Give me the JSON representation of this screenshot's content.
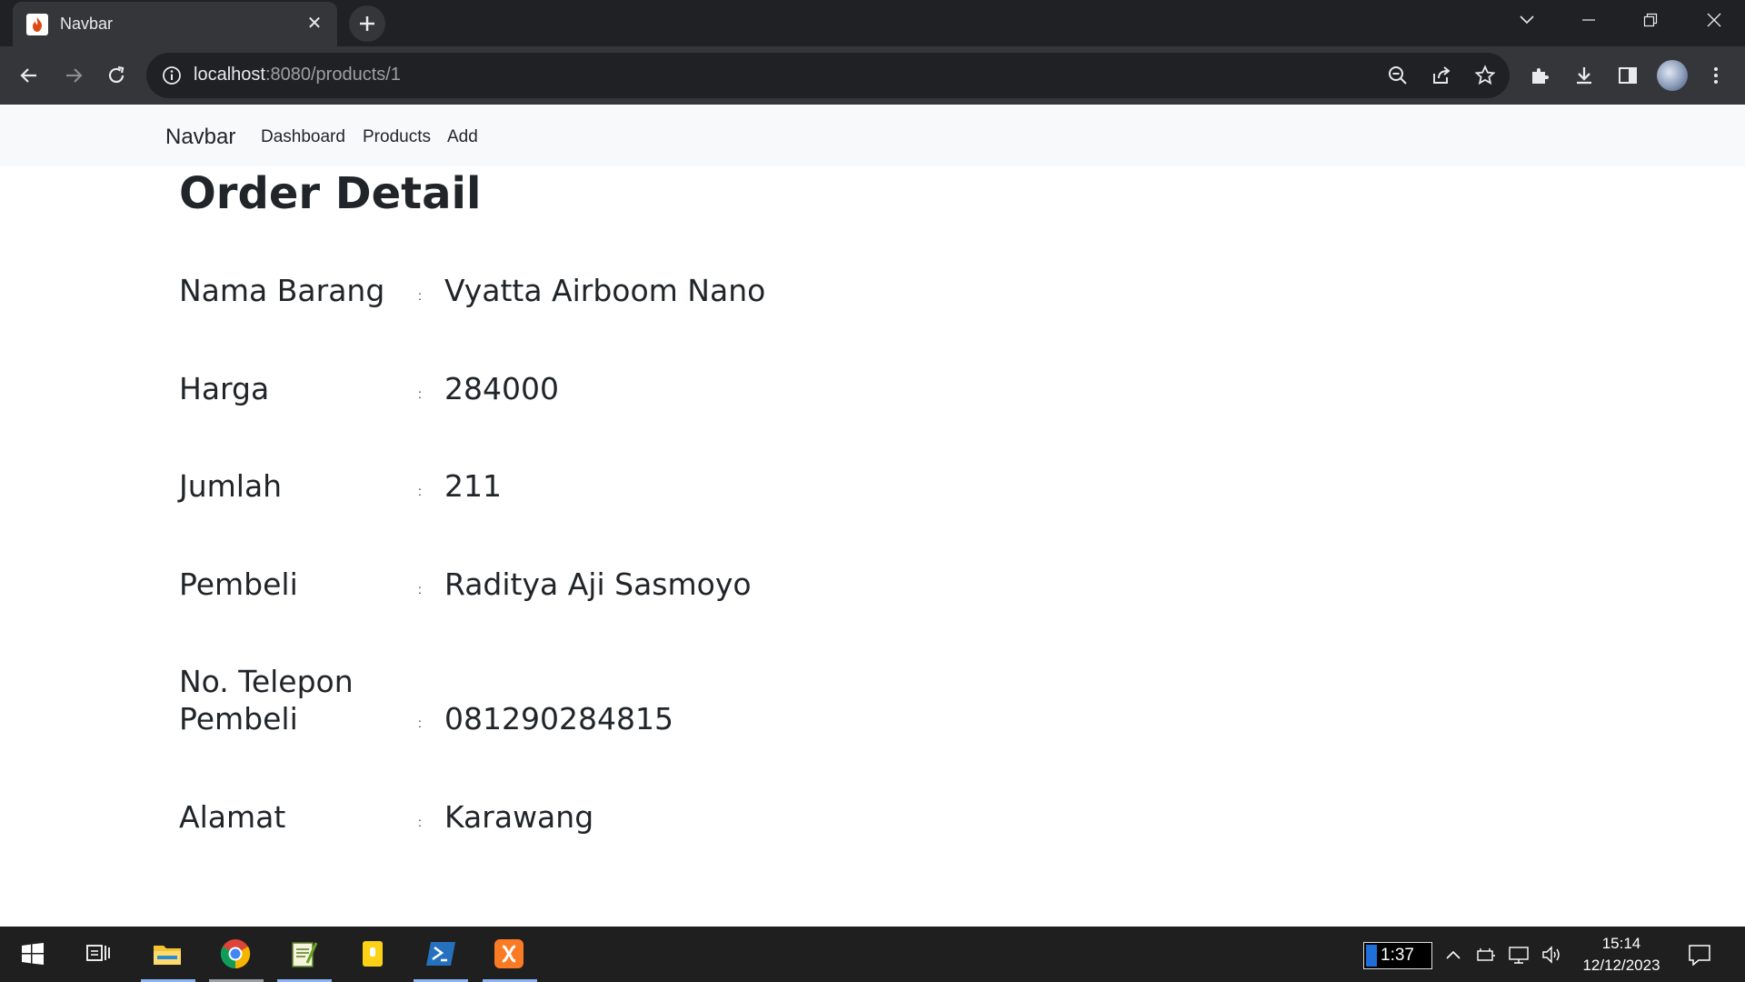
{
  "browser": {
    "tab_title": "Navbar",
    "url_host": "localhost",
    "url_rest": ":8080/products/1"
  },
  "navbar": {
    "brand": "Navbar",
    "links": [
      "Dashboard",
      "Products",
      "Add"
    ]
  },
  "page": {
    "heading": "Order Detail",
    "colon": ":",
    "rows": [
      {
        "label": "Nama Barang",
        "value": "Vyatta Airboom Nano"
      },
      {
        "label": "Harga",
        "value": "284000"
      },
      {
        "label": "Jumlah",
        "value": "211"
      },
      {
        "label": "Pembeli",
        "value": "Raditya Aji Sasmoyo"
      },
      {
        "label": "No. Telepon Pembeli",
        "value": "081290284815"
      },
      {
        "label": "Alamat",
        "value": "Karawang"
      }
    ]
  },
  "taskbar": {
    "battery_text": "1:37",
    "time": "15:14",
    "date": "12/12/2023"
  }
}
